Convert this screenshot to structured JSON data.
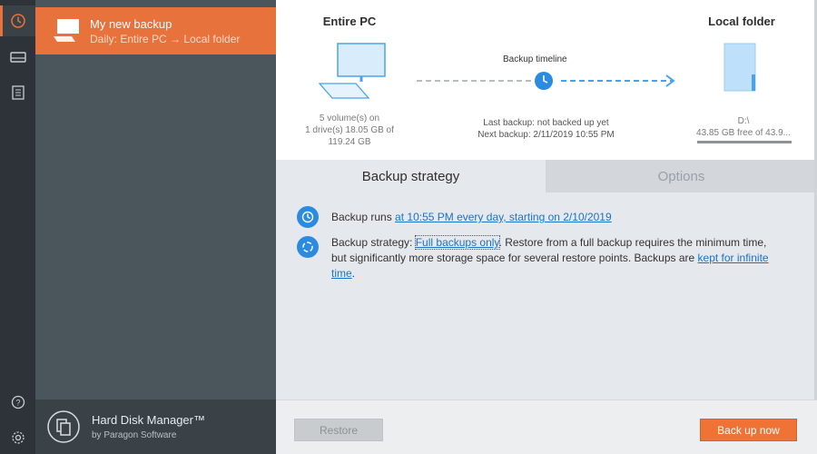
{
  "rail": {
    "icons": [
      "history-icon",
      "drive-icon",
      "log-icon",
      "help-icon",
      "settings-icon"
    ]
  },
  "backup_item": {
    "title": "My new backup",
    "subtitle": "Daily: Entire PC → Local folder"
  },
  "brand": {
    "name": "Hard Disk Manager™",
    "by": "by Paragon Software"
  },
  "summary": {
    "source_title": "Entire PC",
    "source_info_1": "5 volume(s) on",
    "source_info_2": "1 drive(s) 18.05 GB of",
    "source_info_3": "119.24 GB",
    "timeline_label": "Backup timeline",
    "last_backup": "Last backup: not backed up yet",
    "next_backup": "Next backup: 2/11/2019 10:55 PM",
    "dest_title": "Local folder",
    "dest_path": "D:\\",
    "dest_free": "43.85 GB free of 43.9..."
  },
  "tabs": {
    "strategy": "Backup strategy",
    "options": "Options"
  },
  "content": {
    "runs_prefix": "Backup runs ",
    "runs_link": "at 10:55 PM every day, starting on 2/10/2019",
    "strategy_prefix": "Backup strategy: ",
    "strategy_link": "Full backups only",
    "strategy_mid": ". Restore from a full backup requires the minimum time,",
    "strategy_line2": "but significantly more storage space for several restore points. Backups are ",
    "kept_link_1": "kept for infinite",
    "kept_link_2": "time",
    "period": "."
  },
  "footer": {
    "restore": "Restore",
    "backup_now": "Back up now"
  },
  "colors": {
    "accent": "#e7723c",
    "link": "#1a73c8",
    "icon_blue": "#2a8be0"
  }
}
